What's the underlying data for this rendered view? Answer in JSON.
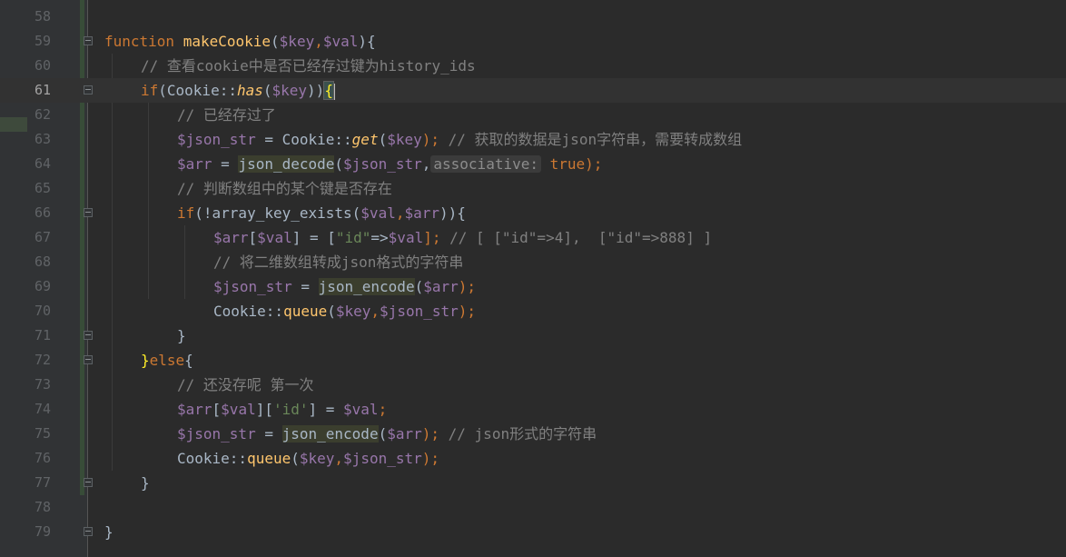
{
  "editor": {
    "language": "PHP",
    "current_line": 61,
    "lines": [
      {
        "num": "58",
        "indent": 0,
        "tokens": []
      },
      {
        "num": "59",
        "indent": 0,
        "fold": true,
        "tokens": [
          {
            "t": "function ",
            "c": "kw"
          },
          {
            "t": "makeCookie",
            "c": "fn"
          },
          {
            "t": "("
          },
          {
            "t": "$key",
            "c": "var"
          },
          {
            "t": ",",
            "c": "kw"
          },
          {
            "t": "$val",
            "c": "var"
          },
          {
            "t": "){"
          }
        ]
      },
      {
        "num": "60",
        "indent": 1,
        "tokens": [
          {
            "t": "// 查看cookie中是否已经存过键为history_ids",
            "c": "cmt"
          }
        ]
      },
      {
        "num": "61",
        "indent": 1,
        "fold": true,
        "current": true,
        "tokens": [
          {
            "t": "if",
            "c": "kw"
          },
          {
            "t": "(Cookie::"
          },
          {
            "t": "has",
            "c": "sfn"
          },
          {
            "t": "("
          },
          {
            "t": "$key",
            "c": "var"
          },
          {
            "t": "))"
          },
          {
            "t": "{",
            "c": "brace-hl"
          },
          {
            "t": "",
            "c": "caret"
          }
        ]
      },
      {
        "num": "62",
        "indent": 2,
        "tokens": [
          {
            "t": "// 已经存过了",
            "c": "cmt"
          }
        ]
      },
      {
        "num": "63",
        "indent": 2,
        "tokens": [
          {
            "t": "$json_str",
            "c": "var"
          },
          {
            "t": " = Cookie::"
          },
          {
            "t": "get",
            "c": "sfn"
          },
          {
            "t": "("
          },
          {
            "t": "$key",
            "c": "var"
          },
          {
            "t": ");",
            "c": "kw"
          },
          {
            "t": " // 获取的数据是json字符串，需要转成数组",
            "c": "cmt"
          }
        ]
      },
      {
        "num": "64",
        "indent": 2,
        "tokens": [
          {
            "t": "$arr",
            "c": "var"
          },
          {
            "t": " = "
          },
          {
            "t": "json_decode",
            "c": "hl"
          },
          {
            "t": "("
          },
          {
            "t": "$json_str",
            "c": "var"
          },
          {
            "t": ","
          },
          {
            "t": "associative:",
            "c": "hint"
          },
          {
            "t": " "
          },
          {
            "t": "true",
            "c": "kw"
          },
          {
            "t": ");",
            "c": "kw"
          }
        ]
      },
      {
        "num": "65",
        "indent": 2,
        "tokens": [
          {
            "t": "// 判断数组中的某个键是否存在",
            "c": "cmt"
          }
        ]
      },
      {
        "num": "66",
        "indent": 2,
        "fold": true,
        "tokens": [
          {
            "t": "if",
            "c": "kw"
          },
          {
            "t": "(!array_key_exists("
          },
          {
            "t": "$val",
            "c": "var"
          },
          {
            "t": ",",
            "c": "kw"
          },
          {
            "t": "$arr",
            "c": "var"
          },
          {
            "t": ")){"
          }
        ]
      },
      {
        "num": "67",
        "indent": 3,
        "tokens": [
          {
            "t": "$arr",
            "c": "var"
          },
          {
            "t": "["
          },
          {
            "t": "$val",
            "c": "var"
          },
          {
            "t": "] = ["
          },
          {
            "t": "\"id\"",
            "c": "str"
          },
          {
            "t": "=>"
          },
          {
            "t": "$val",
            "c": "var"
          },
          {
            "t": "];",
            "c": "kw"
          },
          {
            "t": " // [ [\"id\"=>4],  [\"id\"=>888] ]",
            "c": "cmt"
          }
        ]
      },
      {
        "num": "68",
        "indent": 3,
        "tokens": [
          {
            "t": "// 将二维数组转成json格式的字符串",
            "c": "cmt"
          }
        ]
      },
      {
        "num": "69",
        "indent": 3,
        "tokens": [
          {
            "t": "$json_str",
            "c": "var"
          },
          {
            "t": " = "
          },
          {
            "t": "json_encode",
            "c": "hl"
          },
          {
            "t": "("
          },
          {
            "t": "$arr",
            "c": "var"
          },
          {
            "t": ");",
            "c": "kw"
          }
        ]
      },
      {
        "num": "70",
        "indent": 3,
        "tokens": [
          {
            "t": "Cookie::"
          },
          {
            "t": "queue",
            "c": "mfn"
          },
          {
            "t": "("
          },
          {
            "t": "$key",
            "c": "var"
          },
          {
            "t": ",",
            "c": "kw"
          },
          {
            "t": "$json_str",
            "c": "var"
          },
          {
            "t": ");",
            "c": "kw"
          }
        ]
      },
      {
        "num": "71",
        "indent": 2,
        "fold": true,
        "tokens": [
          {
            "t": "}"
          }
        ]
      },
      {
        "num": "72",
        "indent": 1,
        "fold": true,
        "tokens": [
          {
            "t": "}",
            "c": "bmatch"
          },
          {
            "t": "else",
            "c": "kw"
          },
          {
            "t": "{"
          }
        ]
      },
      {
        "num": "73",
        "indent": 2,
        "tokens": [
          {
            "t": "// 还没存呢 第一次",
            "c": "cmt"
          }
        ]
      },
      {
        "num": "74",
        "indent": 2,
        "tokens": [
          {
            "t": "$arr",
            "c": "var"
          },
          {
            "t": "["
          },
          {
            "t": "$val",
            "c": "var"
          },
          {
            "t": "]["
          },
          {
            "t": "'id'",
            "c": "str"
          },
          {
            "t": "] = "
          },
          {
            "t": "$val",
            "c": "var"
          },
          {
            "t": ";",
            "c": "kw"
          }
        ]
      },
      {
        "num": "75",
        "indent": 2,
        "tokens": [
          {
            "t": "$json_str",
            "c": "var"
          },
          {
            "t": " = "
          },
          {
            "t": "json_encode",
            "c": "hl"
          },
          {
            "t": "("
          },
          {
            "t": "$arr",
            "c": "var"
          },
          {
            "t": ");",
            "c": "kw"
          },
          {
            "t": " // json形式的字符串",
            "c": "cmt"
          }
        ]
      },
      {
        "num": "76",
        "indent": 2,
        "tokens": [
          {
            "t": "Cookie::"
          },
          {
            "t": "queue",
            "c": "mfn"
          },
          {
            "t": "("
          },
          {
            "t": "$key",
            "c": "var"
          },
          {
            "t": ",",
            "c": "kw"
          },
          {
            "t": "$json_str",
            "c": "var"
          },
          {
            "t": ");",
            "c": "kw"
          }
        ]
      },
      {
        "num": "77",
        "indent": 1,
        "fold": true,
        "tokens": [
          {
            "t": "}"
          }
        ]
      },
      {
        "num": "78",
        "indent": 0,
        "tokens": []
      },
      {
        "num": "79",
        "indent": 0,
        "fold": true,
        "tokens": [
          {
            "t": "}"
          }
        ]
      }
    ]
  }
}
